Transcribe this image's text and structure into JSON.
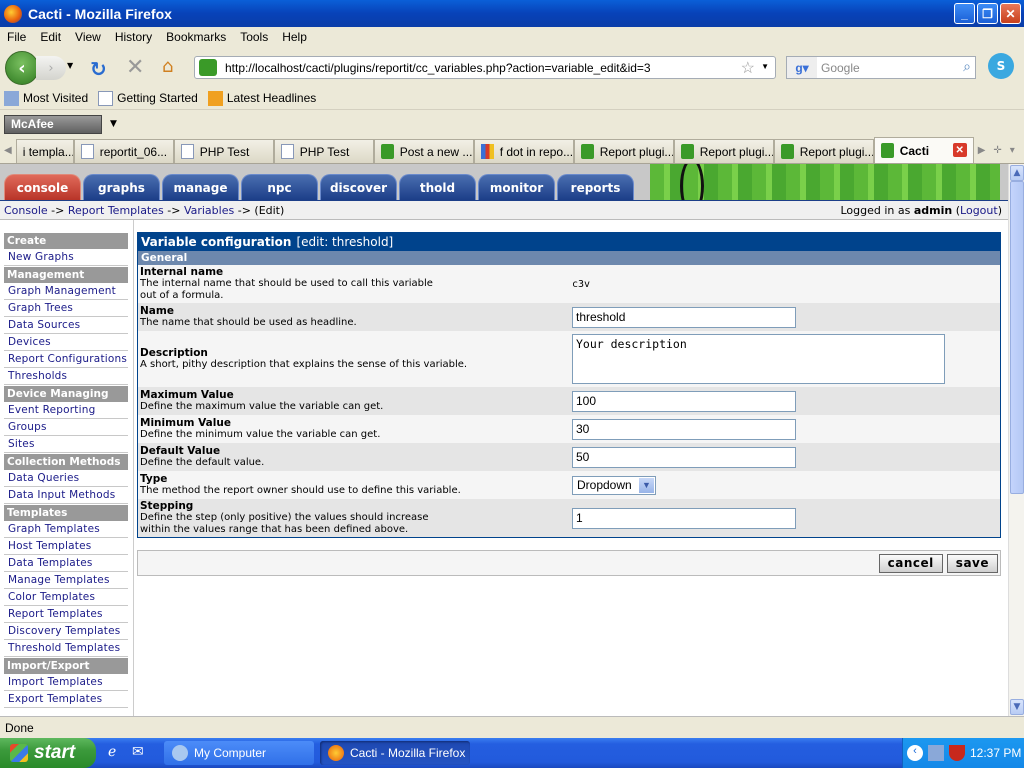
{
  "window": {
    "title": "Cacti - Mozilla Firefox",
    "controls": [
      "minimize",
      "restore",
      "close"
    ]
  },
  "menubar": [
    "File",
    "Edit",
    "View",
    "History",
    "Bookmarks",
    "Tools",
    "Help"
  ],
  "navbar": {
    "url": "http://localhost/cacti/plugins/reportit/cc_variables.php?action=variable_edit&id=3",
    "search_placeholder": "Google"
  },
  "bookmarks": [
    "Most Visited",
    "Getting Started",
    "Latest Headlines"
  ],
  "toolbar": {
    "mcafee_label": "McAfee"
  },
  "tabs": [
    {
      "label": "i templa...",
      "icon": "none"
    },
    {
      "label": "reportit_06...",
      "icon": "page"
    },
    {
      "label": "PHP Test",
      "icon": "page"
    },
    {
      "label": "PHP Test",
      "icon": "page"
    },
    {
      "label": "Post a new ...",
      "icon": "cactus"
    },
    {
      "label": "f dot in repo...",
      "icon": "google"
    },
    {
      "label": "Report plugi...",
      "icon": "cactus"
    },
    {
      "label": "Report plugi...",
      "icon": "cactus"
    },
    {
      "label": "Report plugi...",
      "icon": "cactus"
    },
    {
      "label": "Cacti",
      "icon": "cactus",
      "active": true
    }
  ],
  "cacti": {
    "nav_tabs": [
      "console",
      "graphs",
      "manage",
      "npc",
      "discover",
      "thold",
      "monitor",
      "reports"
    ],
    "active_tab": "console",
    "breadcrumb": {
      "items": [
        "Console",
        "Report Templates",
        "Variables"
      ],
      "separator": "->",
      "current": "(Edit)"
    },
    "login": {
      "prefix": "Logged in as",
      "user": "admin",
      "logout": "Logout"
    },
    "sidebar": [
      {
        "header": "Create",
        "items": [
          "New Graphs"
        ]
      },
      {
        "header": "Management",
        "items": [
          "Graph Management",
          "Graph Trees",
          "Data Sources",
          "Devices",
          "Report Configurations",
          "Thresholds"
        ]
      },
      {
        "header": "Device Managing",
        "items": [
          "Event Reporting",
          "Groups",
          "Sites"
        ]
      },
      {
        "header": "Collection Methods",
        "items": [
          "Data Queries",
          "Data Input Methods"
        ]
      },
      {
        "header": "Templates",
        "items": [
          "Graph Templates",
          "Host Templates",
          "Data Templates",
          "Manage Templates",
          "Color Templates",
          "Report Templates",
          "Discovery Templates",
          "Threshold Templates"
        ]
      },
      {
        "header": "Import/Export",
        "items": [
          "Import Templates",
          "Export Templates"
        ]
      }
    ],
    "form": {
      "title": "Variable configuration",
      "subtitle": "[edit: threshold]",
      "section": "General",
      "fields": {
        "internal_name": {
          "label": "Internal name",
          "desc1": "The internal name that should be used to call this variable",
          "desc2": "out of a formula.",
          "value": "c3v"
        },
        "name": {
          "label": "Name",
          "desc1": "The name that should be used as headline.",
          "value": "threshold"
        },
        "description": {
          "label": "Description",
          "desc1": "A short, pithy description that explains the sense of this variable.",
          "value": "Your description"
        },
        "max": {
          "label": "Maximum Value",
          "desc1": "Define the maximum value the variable can get.",
          "value": "100"
        },
        "min": {
          "label": "Minimum Value",
          "desc1": "Define the minimum value the variable can get.",
          "value": "30"
        },
        "default": {
          "label": "Default Value",
          "desc1": "Define the default value.",
          "value": "50"
        },
        "type": {
          "label": "Type",
          "desc1": "The method the report owner should use to define this variable.",
          "value": "Dropdown"
        },
        "stepping": {
          "label": "Stepping",
          "desc1": "Define the step (only positive) the values should increase",
          "desc2": "within the values range that has been defined above.",
          "value": "1"
        }
      },
      "cancel_label": "cancel",
      "save_label": "save"
    }
  },
  "statusbar": {
    "text": "Done"
  },
  "taskbar": {
    "start_label": "start",
    "tasks": [
      "My Computer",
      "Cacti - Mozilla Firefox"
    ],
    "clock": "12:37 PM"
  },
  "colors": {
    "header_blue": "#00438c",
    "section_blue": "#6d88ad",
    "active_tab_red": "#b83428",
    "link": "#1a1a88"
  }
}
